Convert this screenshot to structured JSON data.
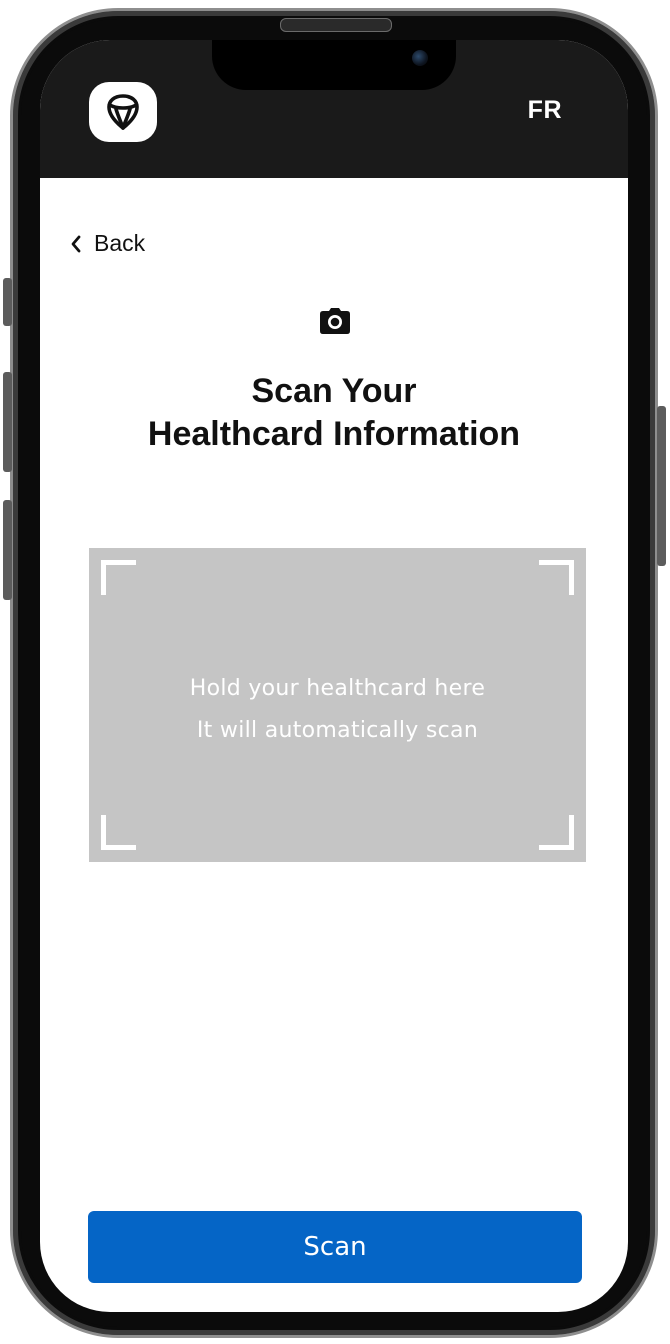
{
  "header": {
    "logo_icon": "ontario-trillium-logo-icon",
    "language_toggle": "FR"
  },
  "nav": {
    "back_label": "Back",
    "back_icon": "chevron-left-icon"
  },
  "main": {
    "title_icon": "camera-icon",
    "title_line1": "Scan Your",
    "title_line2": "Healthcard Information",
    "scan_area": {
      "hint_line1": "Hold your healthcard here",
      "hint_line2": "It will automatically scan"
    },
    "scan_button_label": "Scan"
  },
  "colors": {
    "header_bg": "#1a1a1a",
    "scan_area_bg": "#c5c5c5",
    "primary_button": "#0565c6"
  }
}
